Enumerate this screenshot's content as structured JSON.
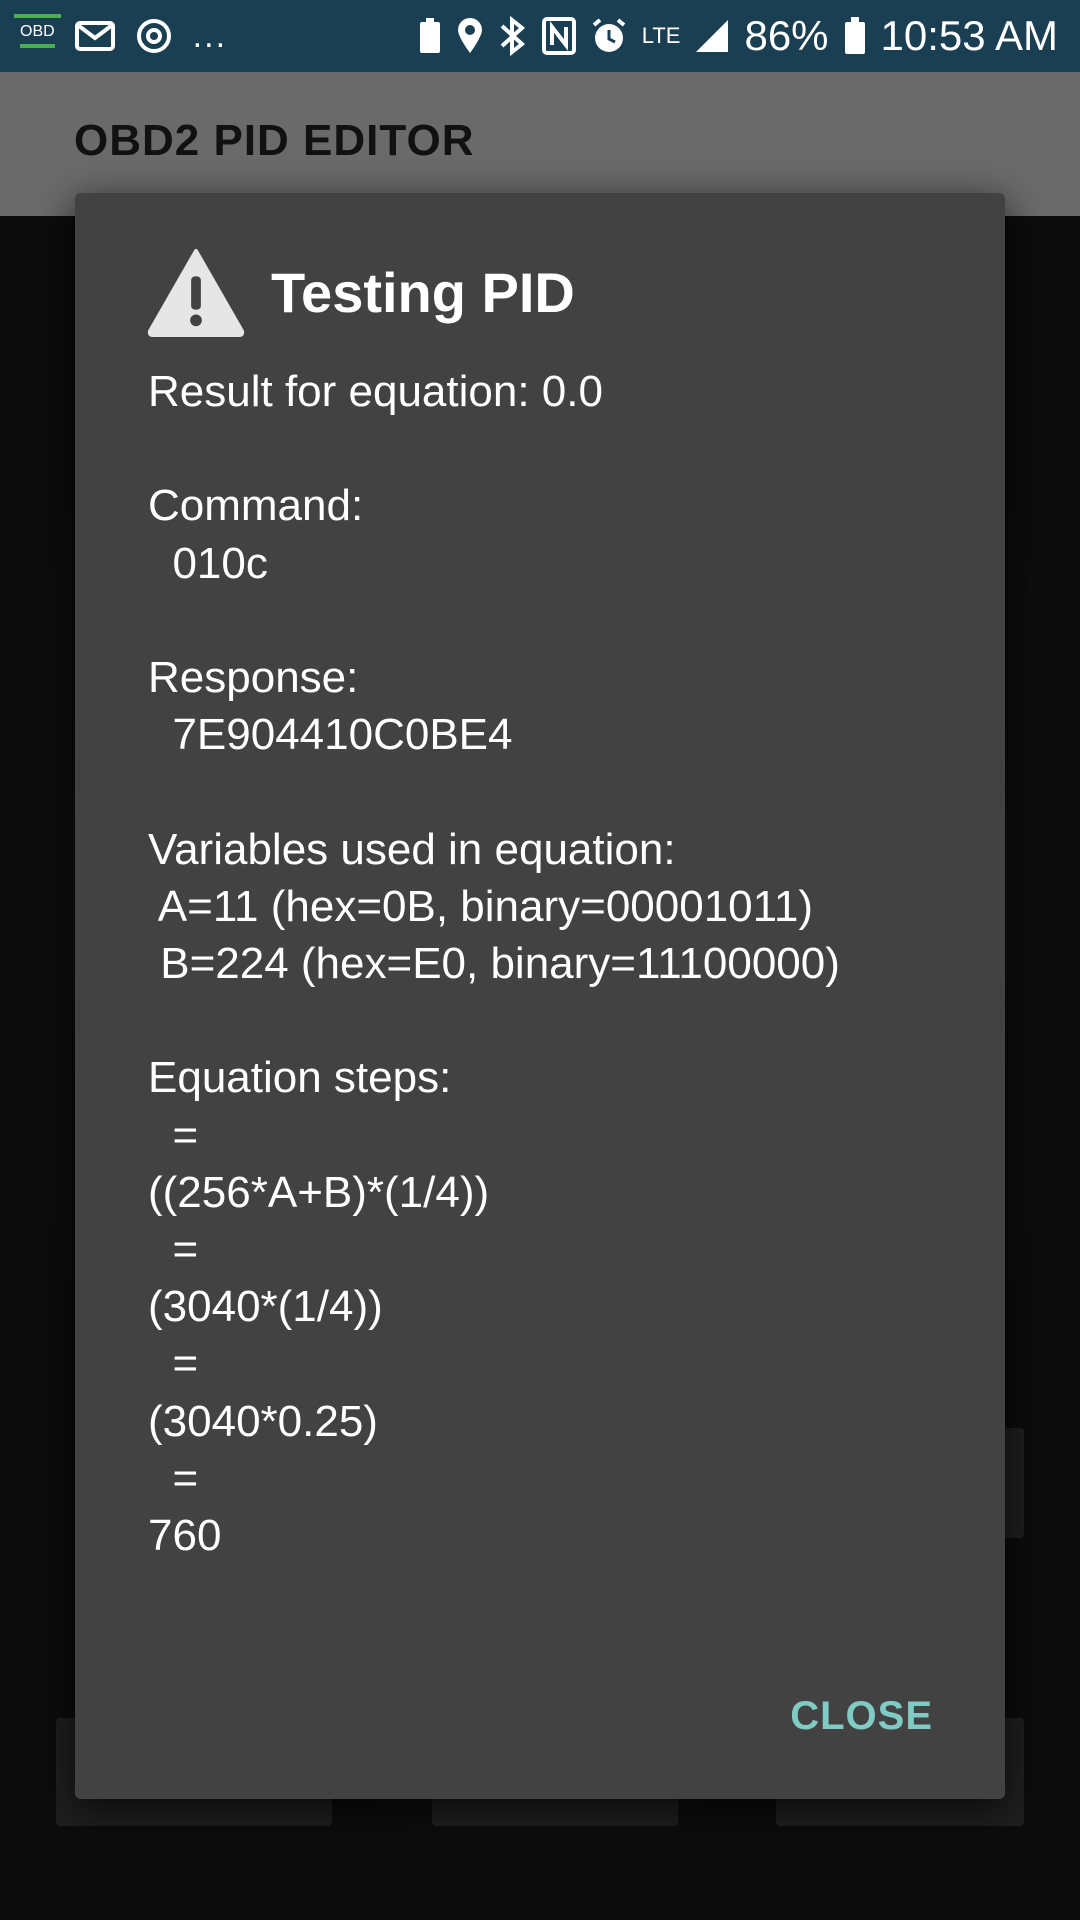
{
  "status_bar": {
    "obd_icon_label": "OBD",
    "overflow": "...",
    "network": "LTE",
    "battery_percent": "86%",
    "time": "10:53 AM"
  },
  "app_bar": {
    "title": "OBD2 PID EDITOR"
  },
  "dialog": {
    "title": "Testing PID",
    "body": "Result for equation: 0.0\n\nCommand:\n  010c\n\nResponse:\n  7E904410C0BE4\n\nVariables used in equation:\n A=11 (hex=0B, binary=00001011)\n B=224 (hex=E0, binary=11100000)\n\nEquation steps:\n  =\n((256*A+B)*(1/4))\n  =\n(3040*(1/4))\n  =\n(3040*0.25)\n  =\n760",
    "close_label": "CLOSE"
  },
  "colors": {
    "status_bar": "#1a3f53",
    "app_bar": "#6a6a6a",
    "dialog_bg": "#424242",
    "accent": "#80cbc4"
  }
}
